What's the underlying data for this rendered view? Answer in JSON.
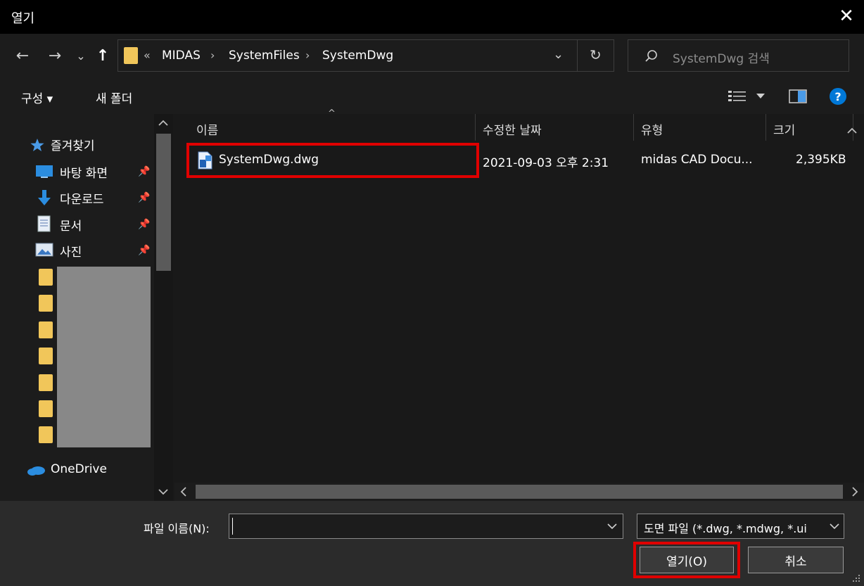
{
  "window": {
    "title": "열기",
    "close_glyph": "✕"
  },
  "nav": {
    "back_glyph": "←",
    "forward_glyph": "→",
    "recent_glyph": "⌄",
    "up_glyph": "↑",
    "breadcrumb_prefix": "«",
    "breadcrumbs": [
      "MIDAS",
      "SystemFiles",
      "SystemDwg"
    ],
    "separator": "›",
    "refresh_glyph": "↻",
    "dropdown_glyph": "⌄"
  },
  "search": {
    "placeholder": "SystemDwg 검색",
    "icon": "search-icon"
  },
  "toolbar": {
    "organize_label": "구성 ▾",
    "new_folder_label": "새 폴더",
    "help_glyph": "?"
  },
  "sidebar": {
    "favorites_label": "즐겨찾기",
    "items": [
      {
        "label": "바탕 화면",
        "icon": "desktop-icon",
        "pinned": true
      },
      {
        "label": "다운로드",
        "icon": "download-icon",
        "pinned": true
      },
      {
        "label": "문서",
        "icon": "document-icon",
        "pinned": true
      },
      {
        "label": "사진",
        "icon": "pictures-icon",
        "pinned": true
      }
    ],
    "pin_glyph": "📌",
    "onedrive_label": "OneDrive"
  },
  "file_list": {
    "columns": [
      "이름",
      "수정한 날짜",
      "유형",
      "크기"
    ],
    "sort_glyph": "^",
    "rows": [
      {
        "name": "SystemDwg.dwg",
        "modified": "2021-09-03 오후 2:31",
        "type": "midas CAD Docu...",
        "size": "2,395KB"
      }
    ]
  },
  "bottom": {
    "filename_label": "파일 이름(N):",
    "filename_value": "",
    "filetype_value": "도면 파일 (*.dwg, *.mdwg, *.ui",
    "open_label": "열기(O)",
    "cancel_label": "취소"
  },
  "colors": {
    "highlight": "#e00000",
    "accent": "#0078d7",
    "folder": "#f1c65a"
  }
}
